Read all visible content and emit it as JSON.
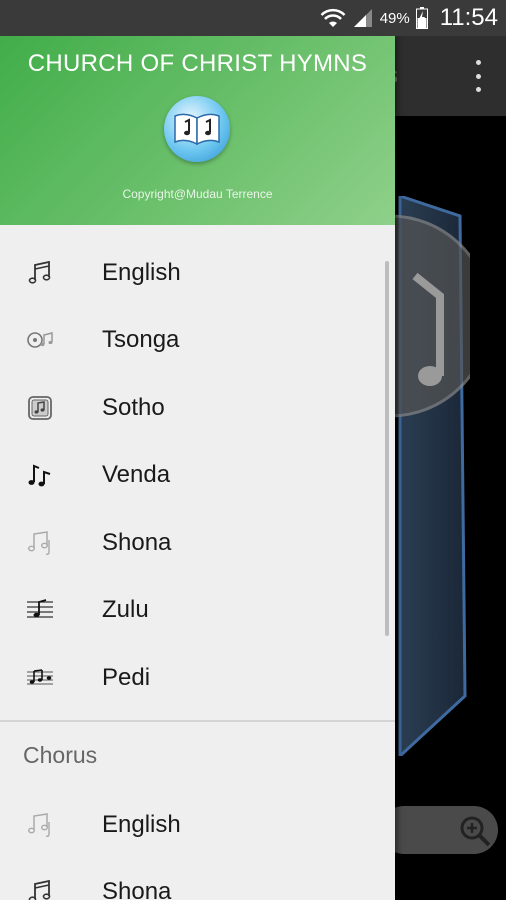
{
  "status_bar": {
    "battery_percent": "49%",
    "time": "11:54",
    "icons": [
      "wifi-icon",
      "signal-icon",
      "battery-charging-icon"
    ]
  },
  "app": {
    "toolbar_partial_text": "s",
    "overflow_icon": "more-vert-icon",
    "search_icon": "zoom-in-icon"
  },
  "drawer": {
    "header": {
      "title": "CHURCH OF CHRIST HYMNS",
      "copyright": "Copyright@Mudau Terrence",
      "logo_icon": "hymn-book-icon"
    },
    "languages": [
      {
        "label": "English",
        "icon": "music-note-icon"
      },
      {
        "label": "Tsonga",
        "icon": "music-cd-icon"
      },
      {
        "label": "Sotho",
        "icon": "music-album-icon"
      },
      {
        "label": "Venda",
        "icon": "music-note-bold-icon"
      },
      {
        "label": "Shona",
        "icon": "music-note-light-icon"
      },
      {
        "label": "Zulu",
        "icon": "music-staff-icon"
      },
      {
        "label": "Pedi",
        "icon": "music-score-icon"
      }
    ],
    "chorus_section": {
      "title": "Chorus",
      "items": [
        {
          "label": "English",
          "icon": "music-note-light-icon"
        },
        {
          "label": "Shona",
          "icon": "music-note-icon"
        }
      ]
    }
  },
  "colors": {
    "header_green": "#41ad49",
    "drawer_bg": "#efefef",
    "status_bar": "#3a3a3a"
  }
}
